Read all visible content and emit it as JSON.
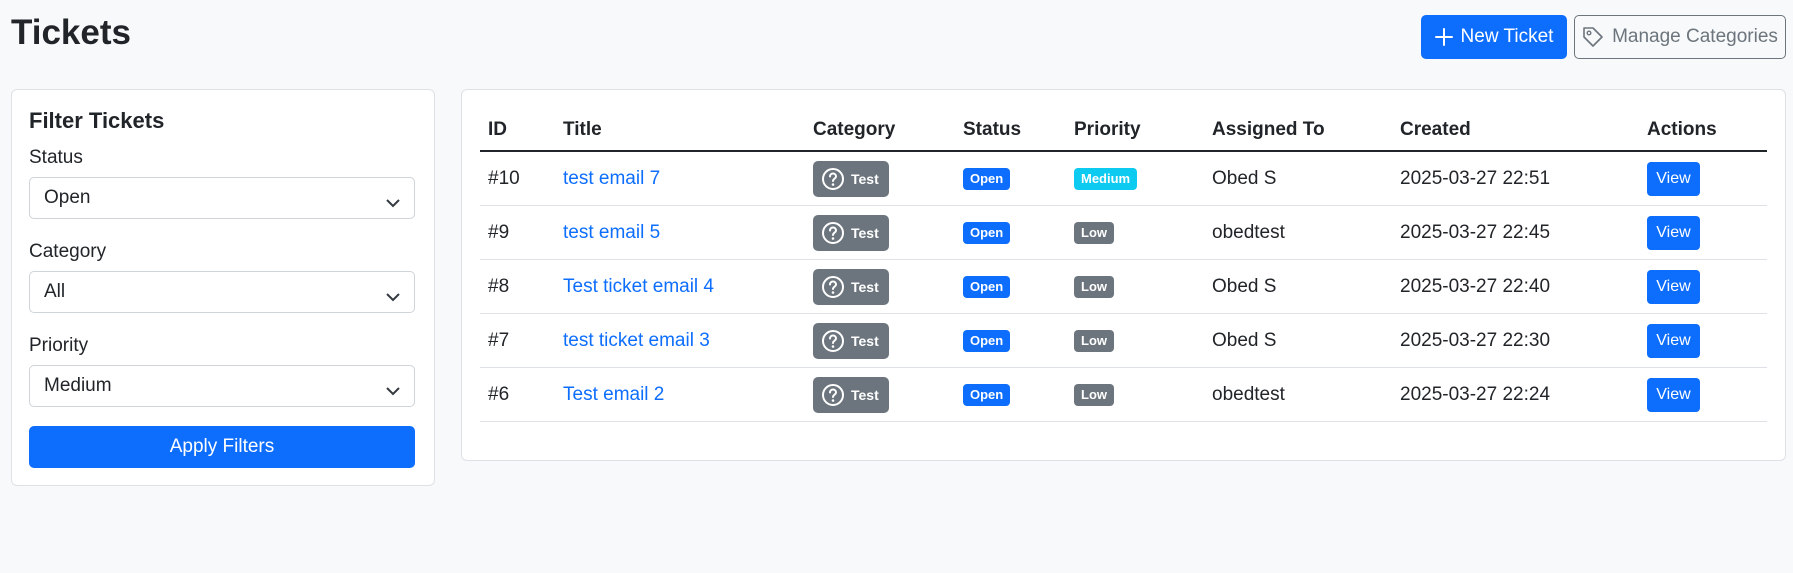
{
  "page": {
    "title": "Tickets"
  },
  "header": {
    "new_ticket_label": "New Ticket",
    "manage_categories_label": "Manage Categories"
  },
  "filter": {
    "title": "Filter Tickets",
    "status_label": "Status",
    "status_value": "Open",
    "category_label": "Category",
    "category_value": "All",
    "priority_label": "Priority",
    "priority_value": "Medium",
    "apply_label": "Apply Filters"
  },
  "table": {
    "headers": [
      "ID",
      "Title",
      "Category",
      "Status",
      "Priority",
      "Assigned To",
      "Created",
      "Actions"
    ],
    "rows": [
      {
        "id": "#10",
        "title": "test email 7",
        "category": "Test",
        "status": "Open",
        "priority": "Medium",
        "assigned": "Obed S",
        "created": "2025-03-27 22:51",
        "action": "View"
      },
      {
        "id": "#9",
        "title": "test email 5",
        "category": "Test",
        "status": "Open",
        "priority": "Low",
        "assigned": "obedtest",
        "created": "2025-03-27 22:45",
        "action": "View"
      },
      {
        "id": "#8",
        "title": "Test ticket email 4",
        "category": "Test",
        "status": "Open",
        "priority": "Low",
        "assigned": "Obed S",
        "created": "2025-03-27 22:40",
        "action": "View"
      },
      {
        "id": "#7",
        "title": "test ticket email 3",
        "category": "Test",
        "status": "Open",
        "priority": "Low",
        "assigned": "Obed S",
        "created": "2025-03-27 22:30",
        "action": "View"
      },
      {
        "id": "#6",
        "title": "Test email 2",
        "category": "Test",
        "status": "Open",
        "priority": "Low",
        "assigned": "obedtest",
        "created": "2025-03-27 22:24",
        "action": "View"
      }
    ]
  },
  "colors": {
    "primary": "#0d6efd",
    "secondary": "#6c757d",
    "medium_priority": "#0dcaf0",
    "low_priority": "#6c757d",
    "background": "#f8f9fa"
  },
  "icons": {
    "new_ticket": "plus-icon",
    "manage_categories": "tag-icon",
    "category": "question-circle-icon",
    "select": "chevron-down-icon"
  }
}
